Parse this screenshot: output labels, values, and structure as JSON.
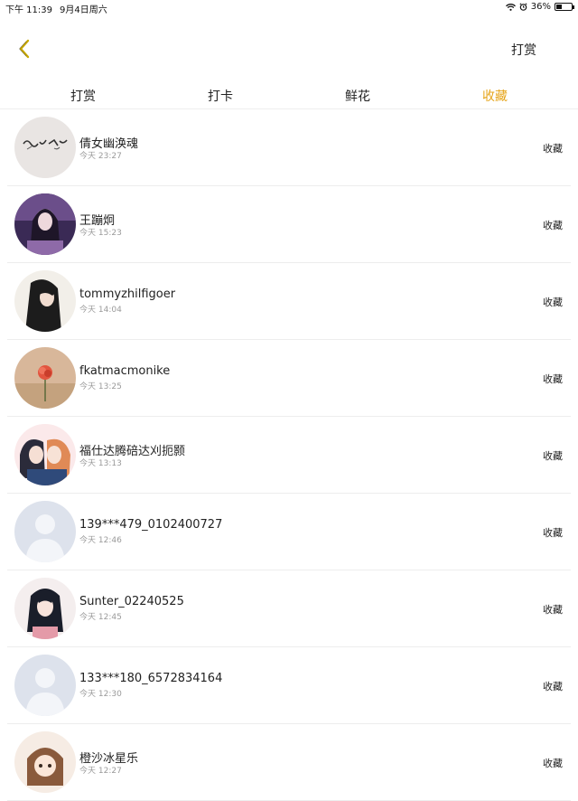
{
  "status_bar": {
    "time": "下午 11:39",
    "date": "9月4日周六",
    "battery": "36%",
    "battery_level": 0.36
  },
  "header": {
    "back_icon": "chevron-left-icon",
    "action_label": "打赏"
  },
  "tabs": [
    {
      "label": "打赏",
      "active": false
    },
    {
      "label": "打卡",
      "active": false
    },
    {
      "label": "鲜花",
      "active": false
    },
    {
      "label": "收藏",
      "active": true
    }
  ],
  "colors": {
    "accent": "#e6a419",
    "back_icon": "#c8a800"
  },
  "list": [
    {
      "name": "倩女幽涣魂",
      "time": "今天 23:27",
      "action": "收藏",
      "avatar": "calligraphy"
    },
    {
      "name": "王蹦炯",
      "time": "今天 15:23",
      "action": "收藏",
      "avatar": "purple-portrait"
    },
    {
      "name": "tommyzhilfigoer",
      "time": "今天 14:04",
      "action": "收藏",
      "avatar": "long-hair"
    },
    {
      "name": "fkatmacmonike",
      "time": "今天 13:25",
      "action": "收藏",
      "avatar": "flower"
    },
    {
      "name": "福仕达腾碚达刈扼颢",
      "time": "今天 13:13",
      "action": "收藏",
      "avatar": "anime-couple"
    },
    {
      "name": "139***479_0102400727",
      "time": "今天 12:46",
      "action": "收藏",
      "avatar": "default"
    },
    {
      "name": "Sunter_02240525",
      "time": "今天 12:45",
      "action": "收藏",
      "avatar": "anime-girl"
    },
    {
      "name": "133***180_6572834164",
      "time": "今天 12:30",
      "action": "收藏",
      "avatar": "default"
    },
    {
      "name": "橙沙冰星乐",
      "time": "今天 12:27",
      "action": "收藏",
      "avatar": "chibi"
    }
  ]
}
